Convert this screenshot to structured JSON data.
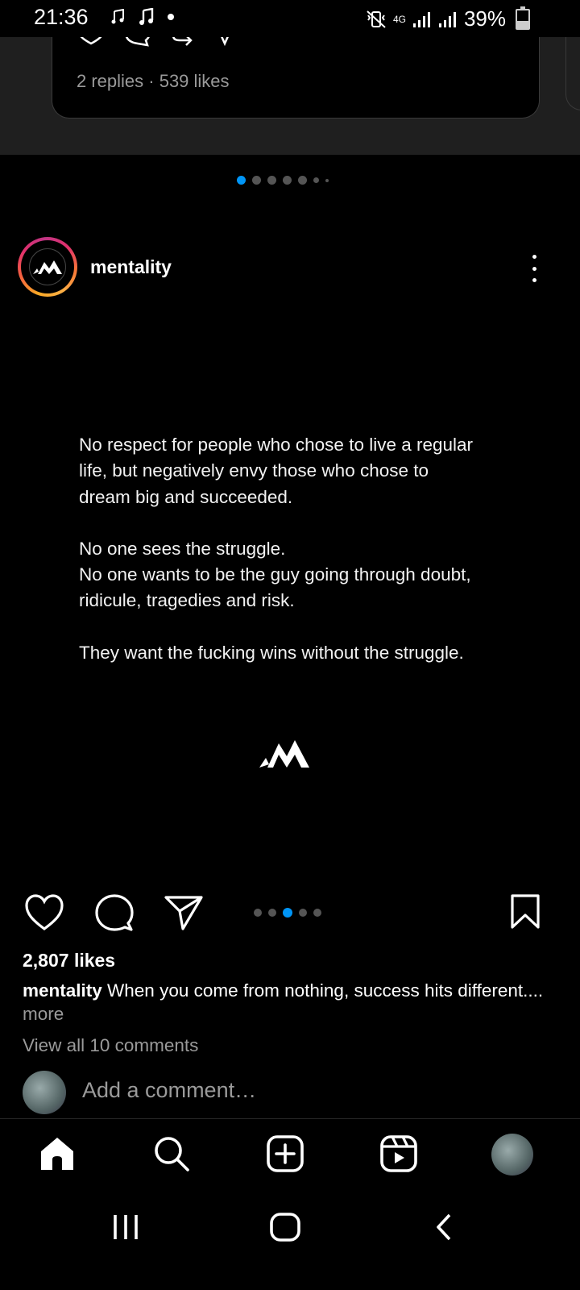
{
  "status_bar": {
    "time": "21:36",
    "network": "4G",
    "battery": "39%",
    "icons": [
      "music-note-icon",
      "music-note-icon",
      "notification-dot-icon",
      "vibrate-mute-icon",
      "signal-icon",
      "signal-icon",
      "battery-icon"
    ]
  },
  "previous_post": {
    "meta": "2 replies · 539 likes"
  },
  "carousel_indicator_top": {
    "count": 7,
    "active_index": 0
  },
  "post": {
    "username": "mentality",
    "paragraphs": [
      "No respect for people who chose to live a regular\nlife, but negatively envy those who chose to\ndream big and succeeded.",
      "No one sees the struggle.\nNo one wants to be the guy going through doubt,\nridicule, tragedies and risk.",
      "They want the fucking wins without the struggle."
    ],
    "carousel": {
      "count": 5,
      "active_index": 2
    },
    "likes": "2,807 likes",
    "caption_user": "mentality",
    "caption_text": "When you come from nothing, success hits different....",
    "more": "more",
    "view_comments": "View all 10 comments",
    "add_comment_placeholder": "Add a comment…"
  },
  "bottom_nav": [
    "home-icon",
    "search-icon",
    "create-icon",
    "reels-icon",
    "profile-avatar"
  ],
  "colors": {
    "accent": "#0095f6",
    "background": "#000000",
    "muted": "#9a9a9a"
  }
}
